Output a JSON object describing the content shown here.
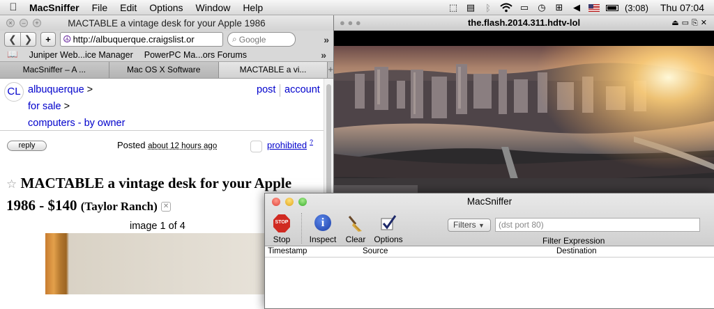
{
  "menubar": {
    "app_name": "MacSniffer",
    "menus": [
      "File",
      "Edit",
      "Options",
      "Window",
      "Help"
    ],
    "battery": "(3:08)",
    "clock": "Thu 07:04"
  },
  "browser": {
    "title": "MACTABLE a vintage desk for your Apple 1986",
    "url": "http://albuquerque.craigslist.or",
    "search_placeholder": "Google",
    "bookmarks": [
      "Juniper Web...ice Manager",
      "PowerPC Ma...ors Forums"
    ],
    "tabs": [
      {
        "label": "MacSniffer – A ...",
        "active": false
      },
      {
        "label": "Mac OS X Software",
        "active": false
      },
      {
        "label": "MACTABLE a vi...",
        "active": true
      }
    ],
    "page": {
      "logo": "CL",
      "breadcrumbs": [
        "albuquerque",
        "for sale",
        "computers - by owner"
      ],
      "crumb_sep": ">",
      "post_link": "post",
      "account_link": "account",
      "reply_label": "reply",
      "posted_label": "Posted",
      "posted_ago": "about 12 hours ago",
      "prohibited_label": "prohibited",
      "prohibited_help": "?",
      "star": "☆",
      "title": "MACTABLE a vintage desk for your Apple 1986 - $140",
      "location": "(Taylor Ranch)",
      "image_count": "image 1 of 4"
    }
  },
  "video": {
    "title": "the.flash.2014.311.hdtv-lol"
  },
  "sniffer": {
    "title": "MacSniffer",
    "toolbar": {
      "stop": "Stop",
      "inspect": "Inspect",
      "clear": "Clear",
      "options": "Options"
    },
    "filters_label": "Filters",
    "filter_placeholder": "(dst port 80)",
    "filter_expression_label": "Filter Expression",
    "columns": [
      "Timestamp",
      "Source",
      "Destination"
    ]
  },
  "colors": {
    "link": "#0000cc",
    "stop_red": "#d02a22",
    "info_blue": "#1c3fa8"
  }
}
